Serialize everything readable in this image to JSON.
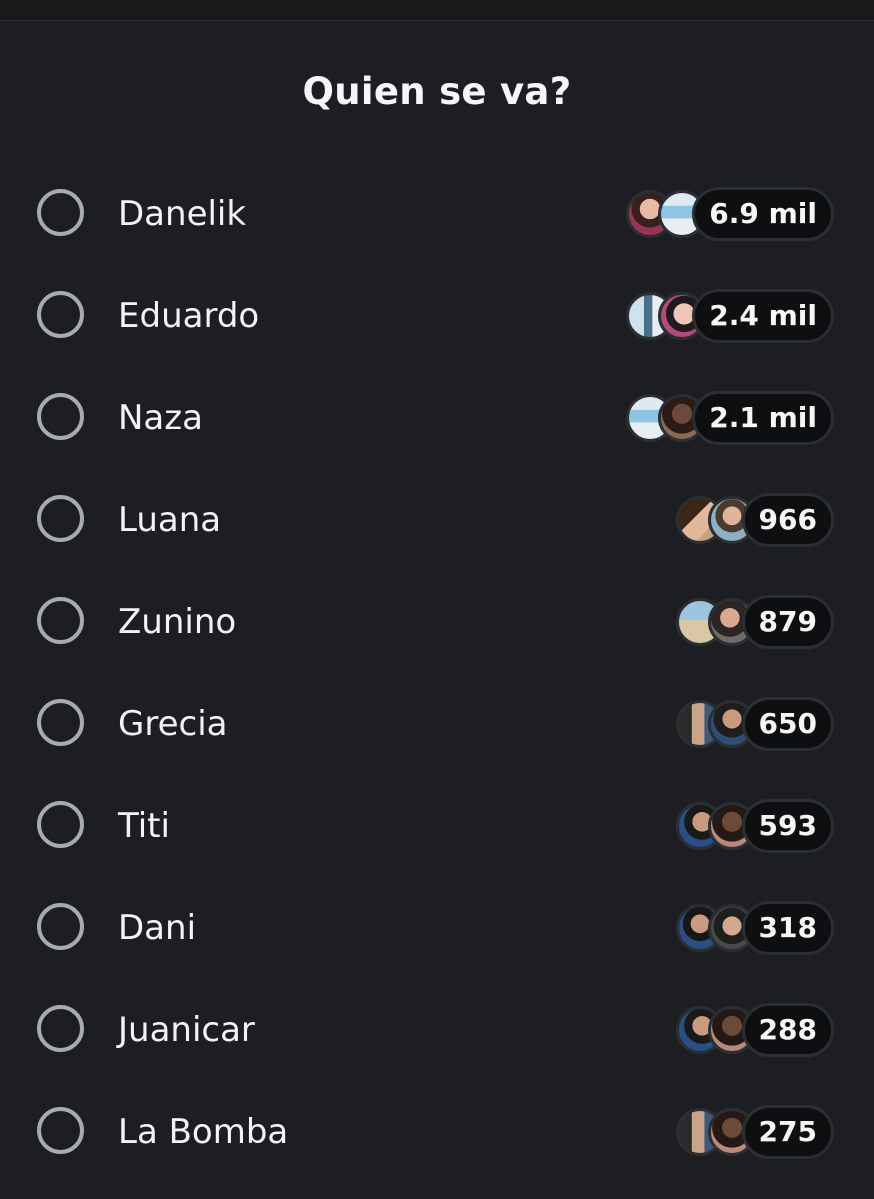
{
  "poll": {
    "title": "Quien se va?",
    "options": [
      {
        "label": "Danelik",
        "count": "6.9 mil"
      },
      {
        "label": "Eduardo",
        "count": "2.4 mil"
      },
      {
        "label": "Naza",
        "count": "2.1 mil"
      },
      {
        "label": "Luana",
        "count": "966"
      },
      {
        "label": "Zunino",
        "count": "879"
      },
      {
        "label": "Grecia",
        "count": "650"
      },
      {
        "label": "Titi",
        "count": "593"
      },
      {
        "label": "Dani",
        "count": "318"
      },
      {
        "label": "Juanicar",
        "count": "288"
      },
      {
        "label": "La Bomba",
        "count": "275"
      }
    ]
  },
  "colors": {
    "background": "#1c1e21",
    "text": "#f2f3f5",
    "radio_border": "#a7abb1",
    "count_pill": "#0e0f11"
  }
}
